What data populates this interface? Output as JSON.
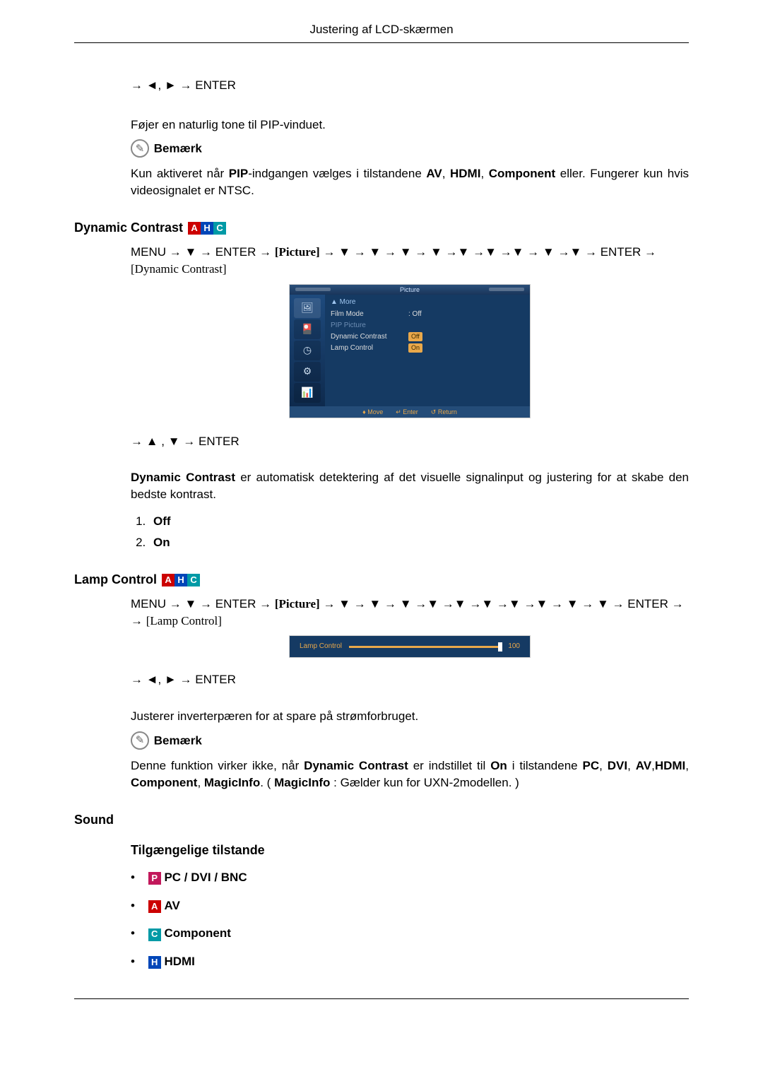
{
  "header": {
    "title": "Justering af LCD-skærmen"
  },
  "nav": {
    "enter": "ENTER"
  },
  "intro": {
    "arrowline": "→ ◄, ► → ENTER",
    "desc": "Føjer en naturlig tone til PIP-vinduet.",
    "noteLabel": "Bemærk",
    "noteText_a": "Kun aktiveret når ",
    "noteText_b": "-indgangen vælges i tilstandene ",
    "noteText_c": " eller. Fungerer kun hvis videosignalet er NTSC.",
    "bold_pip": "PIP",
    "bold_av": "AV",
    "bold_hdmi": "HDMI",
    "bold_comp": "Component"
  },
  "dynamic": {
    "title": "Dynamic Contrast",
    "badges": [
      "A",
      "H",
      "C"
    ],
    "menuPath_a": "MENU → ▼ → ENTER → ",
    "bracket1": "[Picture]",
    "menuPath_b": " → ▼ → ▼ → ▼ → ▼ →▼ →▼ →▼ → ▼ →▼ → ENTER → ",
    "bracket2": "[Dynamic Contrast]",
    "arrowline2": "→ ▲ , ▼ → ENTER",
    "desc_a": "Dynamic Contrast",
    "desc_b": " er automatisk detektering af det visuelle signalinput og justering for at skabe den bedste kontrast.",
    "options": [
      "Off",
      "On"
    ]
  },
  "osd1": {
    "title": "Picture",
    "more": "▲ More",
    "rows": [
      {
        "label": "Film Mode",
        "value": ": Off",
        "disabled": false
      },
      {
        "label": "PIP Picture",
        "value": "",
        "disabled": true
      },
      {
        "label": "Dynamic Contrast",
        "value": "Off",
        "disabled": false,
        "hl": true
      },
      {
        "label": "Lamp Control",
        "value": "On",
        "disabled": false,
        "hl": true
      }
    ],
    "foot": [
      "♦ Move",
      "↵ Enter",
      "↺ Return"
    ]
  },
  "lamp": {
    "title": "Lamp Control",
    "badges": [
      "A",
      "H",
      "C"
    ],
    "menuPath_a": "MENU → ▼ → ENTER → ",
    "bracket1": "[Picture]",
    "menuPath_b": " → ▼ → ▼ → ▼ →▼ →▼ →▼ →▼ →▼ → ▼ → ▼ → ENTER → ",
    "bracket2": "[Lamp Control]",
    "arrowline3": "→ ◄, ► → ENTER",
    "desc": "Justerer inverterpæren for at spare på strømforbruget.",
    "noteLabel": "Bemærk",
    "note_a": "Denne funktion virker ikke, når ",
    "note_dc": "Dynamic Contrast",
    "note_b": " er indstillet til ",
    "note_on": "On",
    "note_c": " i tilstandene ",
    "note_pc": "PC",
    "note_dvi": "DVI",
    "note_av": "AV",
    "note_hdmi": "HDMI",
    "note_comp": "Component",
    "note_magic": "MagicInfo",
    "note_d": ". ( ",
    "note_magic2": "MagicInfo",
    "note_e": " : Gælder kun for UXN-2modellen. )"
  },
  "osd2": {
    "label": "Lamp Control",
    "value": 100,
    "percent": 100
  },
  "sound": {
    "title": "Sound",
    "sub": "Tilgængelige tilstande",
    "modes": [
      {
        "badge": "P",
        "color": "pink",
        "label": "PC / DVI / BNC"
      },
      {
        "badge": "A",
        "color": "red",
        "label": "AV"
      },
      {
        "badge": "C",
        "color": "cyan",
        "label": "Component"
      },
      {
        "badge": "H",
        "color": "blue",
        "label": "HDMI"
      }
    ]
  }
}
